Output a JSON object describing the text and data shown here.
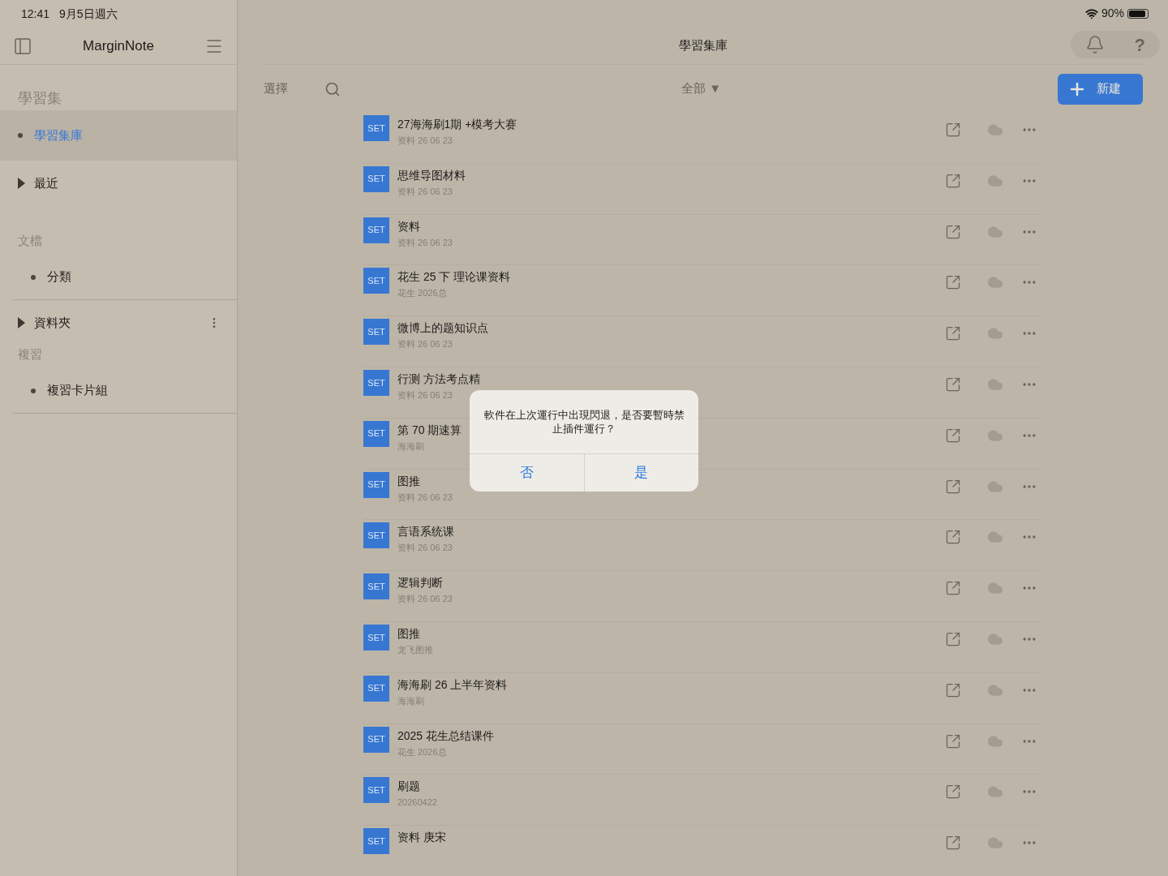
{
  "status_bar": {
    "time": "12:41",
    "date": "9月5日週六",
    "battery": "90%"
  },
  "sidebar": {
    "title": "MarginNote",
    "sections": [
      {
        "heading": "學習集",
        "items": [
          {
            "label": "學習集庫",
            "kind": "bullet",
            "selected": true
          },
          {
            "label": "最近",
            "kind": "arrow",
            "selected": false
          }
        ]
      },
      {
        "heading": "文檔",
        "items": [
          {
            "label": "分類",
            "kind": "bullet",
            "selected": false
          },
          {
            "label": "資料夾",
            "kind": "arrow",
            "selected": false,
            "more": true
          }
        ]
      },
      {
        "heading": "複習",
        "items": [
          {
            "label": "複習卡片組",
            "kind": "bullet",
            "selected": false
          }
        ]
      }
    ]
  },
  "header": {
    "title": "學習集庫",
    "select": "選擇",
    "filter": "全部 ▼",
    "new_button": "新建",
    "help": "?"
  },
  "rows": [
    {
      "badge": "SET",
      "title": "27海海刷1期 +模考大赛",
      "subtitle": "资料 26 06 23"
    },
    {
      "badge": "SET",
      "title": "思维导图材料",
      "subtitle": "资料 26 06 23"
    },
    {
      "badge": "SET",
      "title": "资料",
      "subtitle": "资料 26 06 23"
    },
    {
      "badge": "SET",
      "title": "花生 25 下 理论课资料",
      "subtitle": "花生 2026总"
    },
    {
      "badge": "SET",
      "title": "微博上的题知识点",
      "subtitle": "资料 26 06 23"
    },
    {
      "badge": "SET",
      "title": "行测 方法考点精",
      "subtitle": "资料 26 06 23"
    },
    {
      "badge": "SET",
      "title": "第 70 期速算",
      "subtitle": "海海刷"
    },
    {
      "badge": "SET",
      "title": "图推",
      "subtitle": "资料 26 06 23"
    },
    {
      "badge": "SET",
      "title": "言语系统课",
      "subtitle": "资料 26 06 23"
    },
    {
      "badge": "SET",
      "title": "逻辑判断",
      "subtitle": "资料 26 06 23"
    },
    {
      "badge": "SET",
      "title": "图推",
      "subtitle": "龙飞图推"
    },
    {
      "badge": "SET",
      "title": "海海刷 26 上半年资料",
      "subtitle": "海海刷"
    },
    {
      "badge": "SET",
      "title": "2025 花生总结课件",
      "subtitle": "花生 2026总"
    },
    {
      "badge": "SET",
      "title": "刷题",
      "subtitle": "20260422"
    },
    {
      "badge": "SET",
      "title": "资料 庚宋"
    }
  ],
  "dialog": {
    "message": "軟件在上次運行中出現閃退，是否要暫時禁止插件運行？",
    "buttons": [
      "否",
      "是"
    ]
  }
}
